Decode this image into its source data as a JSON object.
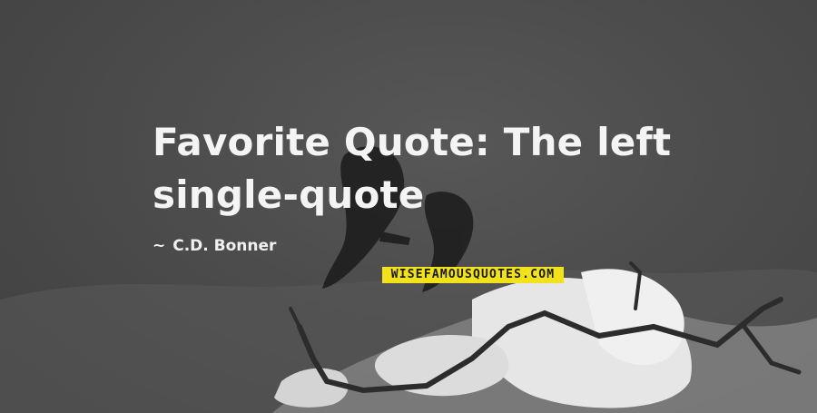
{
  "quote": {
    "text": "Favorite Quote: The left single-quote",
    "author_dash": "~",
    "author": "C.D. Bonner"
  },
  "brand": {
    "label": "WISEFAMOUSQUOTES.COM",
    "color": "#f1e21c"
  },
  "colors": {
    "background": "#4a4a4a",
    "text": "#f4f4f4"
  }
}
